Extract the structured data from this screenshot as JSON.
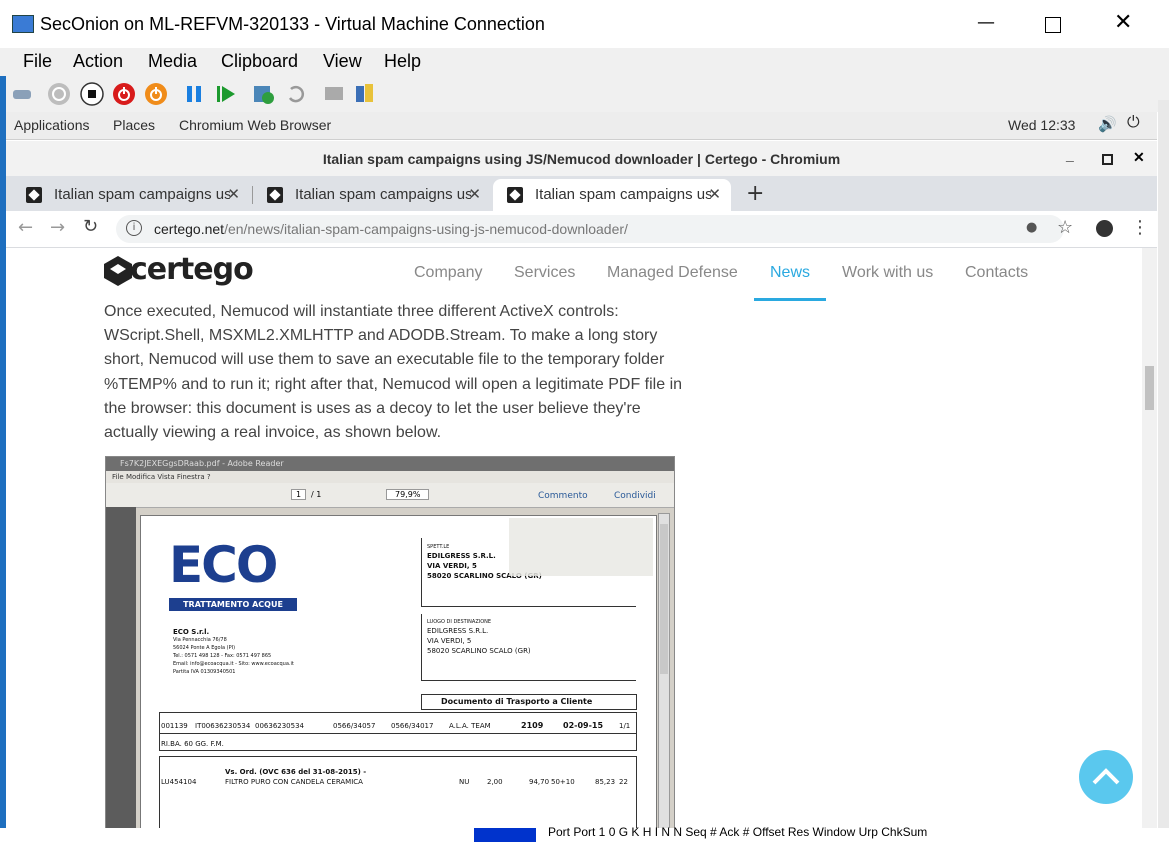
{
  "vm": {
    "title": "SecOnion on ML-REFVM-320133 - Virtual Machine Connection",
    "menu": [
      "File",
      "Action",
      "Media",
      "Clipboard",
      "View",
      "Help"
    ],
    "toolbar_icons": [
      "ctrl-alt-del-icon",
      "start-icon",
      "turnoff-icon",
      "shutdown-icon",
      "save-icon",
      "pause-icon",
      "reset-icon",
      "checkpoint-icon",
      "revert-icon",
      "enhanced-session-icon",
      "share-icon"
    ]
  },
  "gnome": {
    "applications": "Applications",
    "places": "Places",
    "app": "Chromium Web Browser",
    "clock": "Wed 12:33"
  },
  "chromium": {
    "window_title": "Italian spam campaigns using JS/Nemucod downloader | Certego - Chromium",
    "tabs": [
      {
        "label": "Italian spam campaigns us"
      },
      {
        "label": "Italian spam campaigns us"
      },
      {
        "label": "Italian spam campaigns us"
      }
    ],
    "url_host": "certego.net",
    "url_path": "/en/news/italian-spam-campaigns-using-js-nemucod-downloader/"
  },
  "page": {
    "logo": "certego",
    "nav": [
      "Company",
      "Services",
      "Managed Defense",
      "News",
      "Work with us",
      "Contacts"
    ],
    "active_nav": "News",
    "paragraph": "Once executed, Nemucod will instantiate three different ActiveX controls: WScript.Shell, MSXML2.XMLHTTP and ADODB.Stream. To make a long story short, Nemucod will use them to save an executable file to the temporary folder %TEMP% and to run it; right after that, Nemucod will open a legitimate PDF file in the browser: this document is uses as a decoy to let the user believe they're actually viewing a real invoice, as shown below.",
    "embed": {
      "window_title": "Fs7K2JEXEGgsDRaab.pdf - Adobe Reader",
      "menu": "File  Modifica  Vista  Finestra  ?",
      "page_num": "1",
      "page_total": "/ 1",
      "zoom": "79,9%",
      "commento": "Commento",
      "condividi": "Condividi",
      "eco_logo": "ECO",
      "eco_sub": "TRATTAMENTO ACQUE",
      "company": "ECO S.r.l.",
      "address": "Via Pennacchia 76/78",
      "city": "56024 Ponte A Egola (PI)",
      "phone": "Tel.: 0571 498 128 - Fax: 0571 497 865",
      "email": "Email: info@ecoacqua.it - Sito: www.ecoacqua.it",
      "piva": "Partita IVA 01309340501",
      "spett": "SPETT.LE",
      "client_name": "EDILGRESS  S.R.L.",
      "client_street": "VIA VERDI, 5",
      "client_city": "58020 SCARLINO SCALO (GR)",
      "luogo": "LUOGO DI DESTINAZIONE",
      "dest_name": "EDILGRESS  S.R.L.",
      "dest_street": "VIA VERDI, 5",
      "dest_city": "58020 SCARLINO SCALO (GR)",
      "doc_title": "Documento di Trasporto a Cliente",
      "cod": "001139",
      "piva_cli": "IT00636230534",
      "cf": "00636230534",
      "tel": "0566/34057",
      "fax": "0566/34017",
      "agente": "A.L.A. TEAM",
      "num_doc": "2109",
      "data_doc": "02-09-15",
      "pag": "1/1",
      "pagamento": "RI.BA. 60 GG. F.M.",
      "item_code": "LU454104",
      "item_desc1": "Vs. Ord. (OVC 636 del 31-08-2015) -",
      "item_desc2": "FILTRO PURO CON CANDELA CERAMICA",
      "um": "NU",
      "qta": "2,00",
      "prezzo": "94,70",
      "sconto": "50+10",
      "totale": "85,23",
      "iva": "22"
    }
  },
  "bottom_overflow": "Port      Port    1  0  G  K  H  I  N  N      Seq #          Ack #       Offset  Res  Window  Urp  ChkSum"
}
